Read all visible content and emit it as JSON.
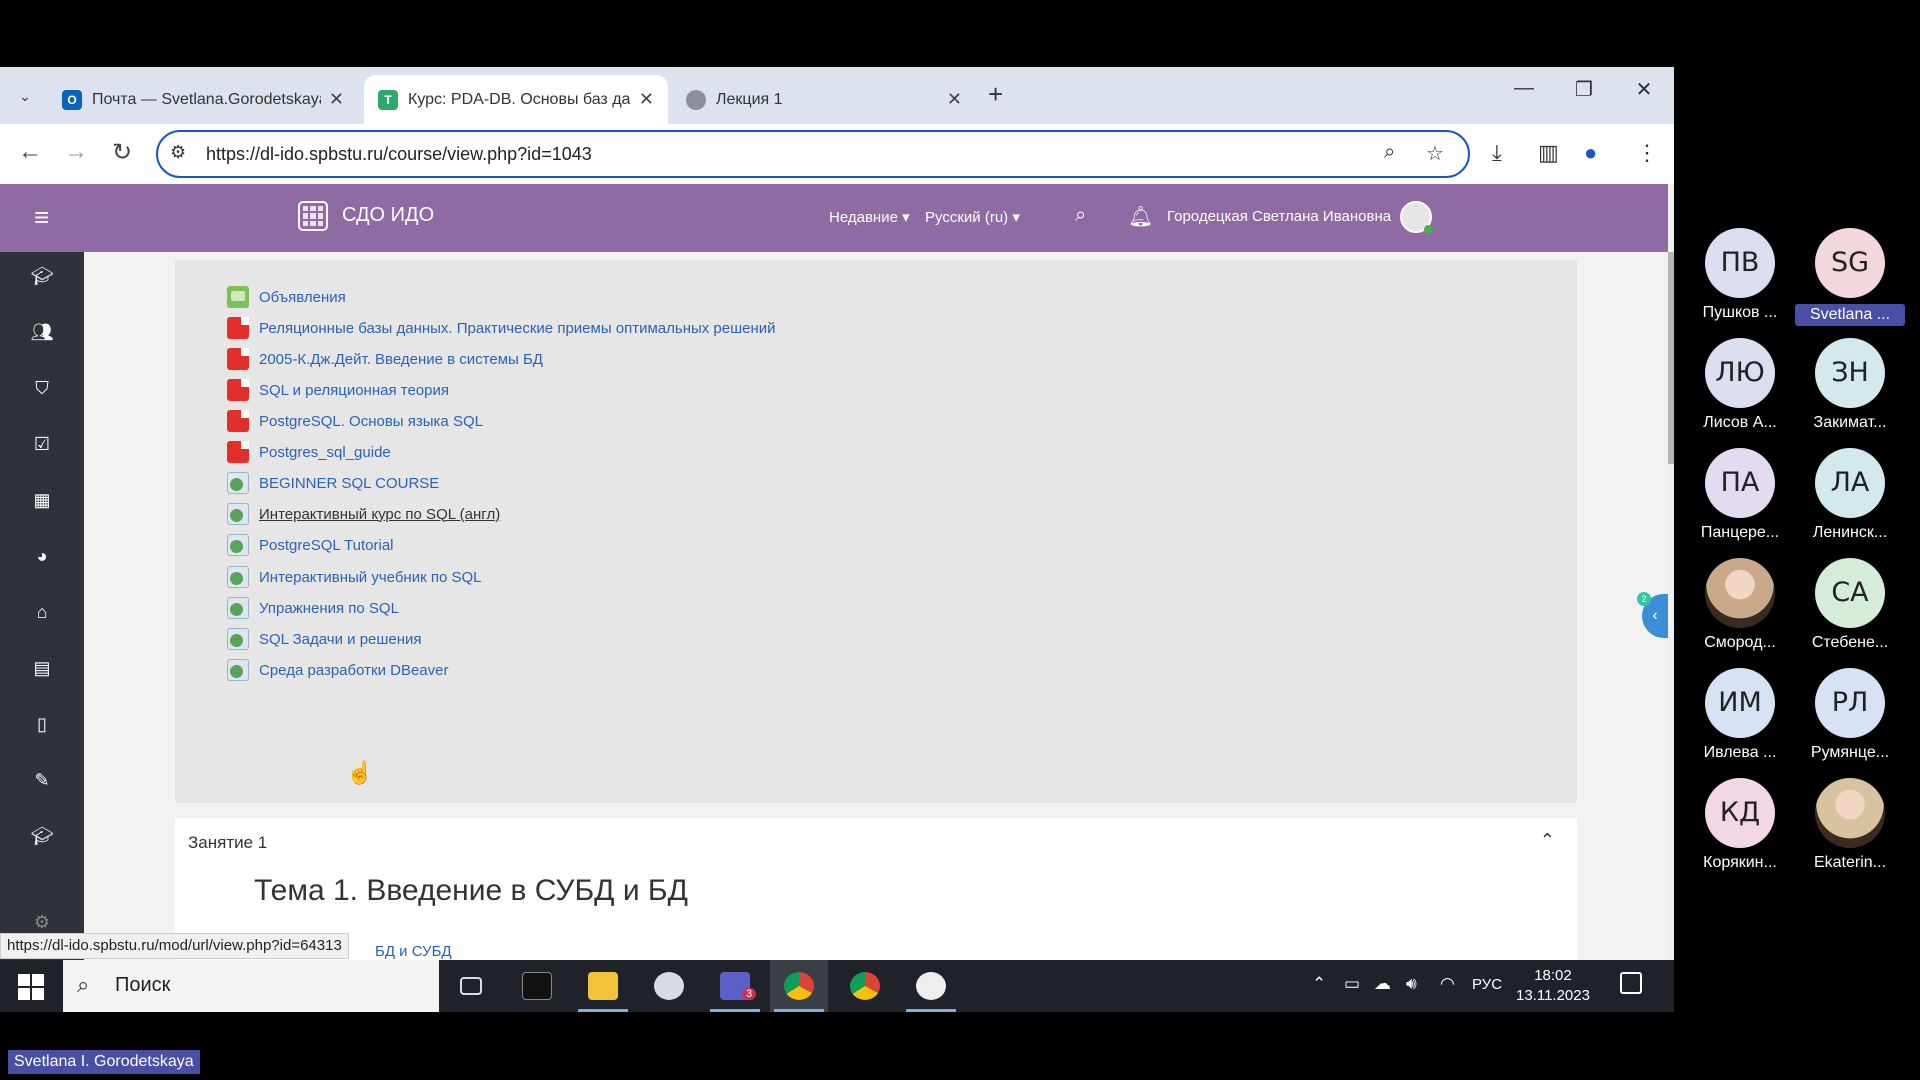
{
  "browser": {
    "tabs": [
      {
        "title": "Почта — Svetlana.Gorodetskaya",
        "favicon": "outlook-icon",
        "active": false
      },
      {
        "title": "Курс: PDA-DB. Основы баз данных",
        "favicon": "moodle-icon",
        "active": true
      },
      {
        "title": "Лекция 1",
        "favicon": "globe-icon",
        "active": false
      }
    ],
    "url": "https://dl-ido.spbstu.ru/course/view.php?id=1043",
    "status_url": "https://dl-ido.spbstu.ru/mod/url/view.php?id=64313"
  },
  "header": {
    "site_name": "СДО ИДО",
    "recent_menu": "Недавние",
    "language_menu": "Русский (ru)",
    "user_name": "Городецкая Светлана Ивановна",
    "color": "#8f6aa3"
  },
  "resources": [
    {
      "label": "Объявления",
      "icon": "forum"
    },
    {
      "label": "Реляционные базы данных. Практические приемы оптимальных решений",
      "icon": "pdf"
    },
    {
      "label": "2005-К.Дж.Дейт. Введение в системы БД",
      "icon": "pdf"
    },
    {
      "label": "SQL и реляционная теория",
      "icon": "pdf"
    },
    {
      "label": "PostgreSQL. Основы языка SQL",
      "icon": "pdf"
    },
    {
      "label": "Postgres_sql_guide",
      "icon": "pdf"
    },
    {
      "label": "BEGINNER SQL COURSE",
      "icon": "url"
    },
    {
      "label": "Интерактивный курс по SQL (англ)",
      "icon": "url"
    },
    {
      "label": "PostgreSQL Tutorial",
      "icon": "url"
    },
    {
      "label": "Интерактивный учебник по SQL",
      "icon": "url"
    },
    {
      "label": " Упражнения по SQL",
      "icon": "url"
    },
    {
      "label": "SQL Задачи и решения",
      "icon": "url"
    },
    {
      "label": "Среда разработки DBeaver",
      "icon": "url"
    }
  ],
  "section": {
    "name": "Занятие 1",
    "topic": "Тема 1. Введение в СУБД и БД",
    "first_item": "БД и СУБД"
  },
  "sidebar_toggle_badge": "2",
  "taskbar": {
    "search_placeholder": "Поиск",
    "language": "РУС",
    "time": "18:02",
    "date": "13.11.2023",
    "teams_badge": "3"
  },
  "participants": [
    {
      "initials": "ПВ",
      "name": "Пушков ...",
      "color": "#dcdff0",
      "photo": false
    },
    {
      "initials": "SG",
      "name": "Svetlana ...",
      "color": "#f2d7dc",
      "photo": false,
      "highlight": true
    },
    {
      "initials": "ЛЮ",
      "name": "Лисов А...",
      "color": "#dcdff0",
      "photo": false
    },
    {
      "initials": "ЗН",
      "name": "Закимат...",
      "color": "#d3e9ec",
      "photo": false
    },
    {
      "initials": "ПА",
      "name": "Панцере...",
      "color": "#e4dbf0",
      "photo": false
    },
    {
      "initials": "ЛА",
      "name": "Ленинск...",
      "color": "#d3e9ec",
      "photo": false
    },
    {
      "initials": "",
      "name": "Смород...",
      "color": "#c9a98a",
      "photo": true
    },
    {
      "initials": "СА",
      "name": "Стебене...",
      "color": "#d4ecd8",
      "photo": false
    },
    {
      "initials": "ИМ",
      "name": "Ивлева ...",
      "color": "#d7e3f4",
      "photo": false
    },
    {
      "initials": "РЛ",
      "name": "Румянце...",
      "color": "#d7e3f4",
      "photo": false
    },
    {
      "initials": "КД",
      "name": "Корякин...",
      "color": "#f2d7e6",
      "photo": false
    },
    {
      "initials": "",
      "name": "Ekaterin...",
      "color": "#d8c3a0",
      "photo": true
    }
  ],
  "presenter_label": "Svetlana I. Gorodetskaya"
}
